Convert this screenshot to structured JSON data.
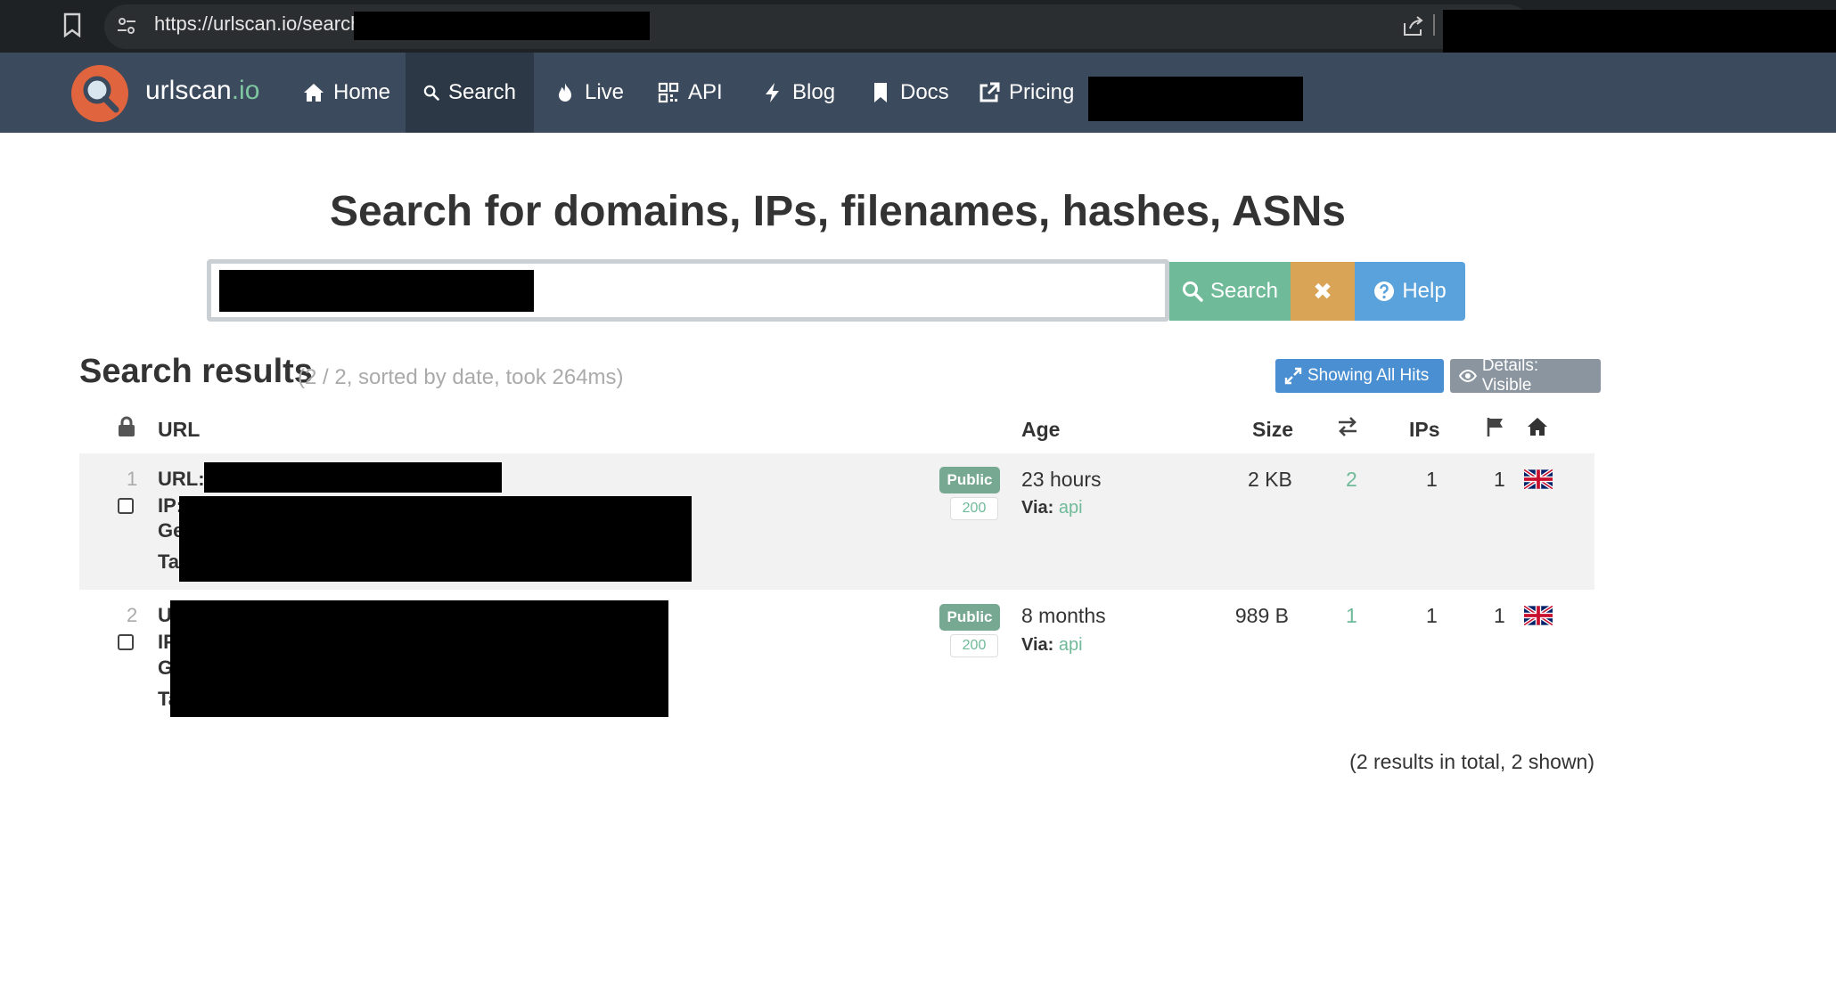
{
  "browser": {
    "url": "https://urlscan.io/search/"
  },
  "navbar": {
    "brand_name": "urlscan",
    "brand_tld": ".io",
    "items": [
      {
        "label": "Home",
        "icon": "home-icon"
      },
      {
        "label": "Search",
        "icon": "search-icon"
      },
      {
        "label": "Live",
        "icon": "fire-icon"
      },
      {
        "label": "API",
        "icon": "qrcode-icon"
      },
      {
        "label": "Blog",
        "icon": "bolt-icon"
      },
      {
        "label": "Docs",
        "icon": "bookmark-icon"
      },
      {
        "label": "Pricing",
        "icon": "external-link-icon"
      }
    ],
    "active": "Search"
  },
  "search": {
    "heading": "Search for domains, IPs, filenames, hashes, ASNs",
    "search_label": "Search",
    "clear_label": "✖",
    "help_label": "Help"
  },
  "results": {
    "title": "Search results",
    "subtitle": "(2 / 2, sorted by date, took 264ms)",
    "showing_all_hits": "Showing All Hits",
    "details_visible": "Details: Visible",
    "columns": {
      "url": "URL",
      "age": "Age",
      "size": "Size",
      "ips": "IPs"
    },
    "rows": [
      {
        "num": "1",
        "url_label": "URL:",
        "ip_label": "IP:",
        "geo_label": "Ge",
        "tags_label": "Ta",
        "visibility": "Public",
        "status": "200",
        "age": "23 hours",
        "via_label": "Via:",
        "via": "api",
        "size": "2 KB",
        "requests": "2",
        "ips": "1",
        "countries": "1",
        "country_flag": "uk-flag"
      },
      {
        "num": "2",
        "url_label": "U",
        "ip_label": "IP",
        "geo_label": "G",
        "tags_label": "Ta",
        "visibility": "Public",
        "status": "200",
        "age": "8 months",
        "via_label": "Via:",
        "via": "api",
        "size": "989 B",
        "requests": "1",
        "ips": "1",
        "countries": "1",
        "country_flag": "uk-flag"
      }
    ],
    "footer": "(2 results in total, 2 shown)"
  },
  "colors": {
    "navbar": "#3b4a5c",
    "accent_green": "#6fba99",
    "clear_orange": "#d9a455",
    "help_blue": "#5aa2dc"
  }
}
